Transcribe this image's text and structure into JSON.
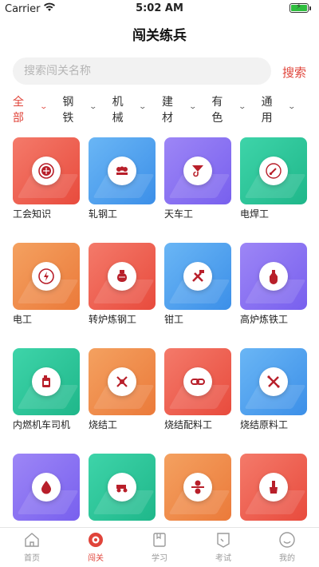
{
  "status": {
    "carrier": "Carrier",
    "time": "5:02 AM",
    "battery_level": 1.0,
    "battery_color": "#2fbf3f"
  },
  "header": {
    "title": "闯关练兵"
  },
  "search": {
    "placeholder": "搜索闯关名称",
    "value": "",
    "button_label": "搜索"
  },
  "filters": [
    {
      "label": "全部",
      "active": true
    },
    {
      "label": "钢铁",
      "active": false
    },
    {
      "label": "机械",
      "active": false
    },
    {
      "label": "建材",
      "active": false
    },
    {
      "label": "有色",
      "active": false
    },
    {
      "label": "通用",
      "active": false
    }
  ],
  "cards": [
    {
      "label": "工会知识",
      "color": "red",
      "icon": "union-badge-icon"
    },
    {
      "label": "轧钢工",
      "color": "blue",
      "icon": "rolling-mill-icon"
    },
    {
      "label": "天车工",
      "color": "purple",
      "icon": "crane-hook-icon"
    },
    {
      "label": "电焊工",
      "color": "green",
      "icon": "welding-icon"
    },
    {
      "label": "电工",
      "color": "orange",
      "icon": "electric-meter-icon"
    },
    {
      "label": "转炉炼钢工",
      "color": "red",
      "icon": "converter-icon"
    },
    {
      "label": "钳工",
      "color": "blue",
      "icon": "tools-icon"
    },
    {
      "label": "高炉炼铁工",
      "color": "purple",
      "icon": "blast-furnace-icon"
    },
    {
      "label": "内燃机车司机",
      "color": "green",
      "icon": "fuel-can-icon"
    },
    {
      "label": "烧结工",
      "color": "orange",
      "icon": "sinter-icon"
    },
    {
      "label": "烧结配料工",
      "color": "red",
      "icon": "chain-link-icon"
    },
    {
      "label": "烧结原料工",
      "color": "blue",
      "icon": "raw-material-icon"
    },
    {
      "label": "",
      "color": "purple",
      "icon": "droplet-icon"
    },
    {
      "label": "",
      "color": "green",
      "icon": "tractor-icon"
    },
    {
      "label": "",
      "color": "orange",
      "icon": "rollers-icon"
    },
    {
      "label": "",
      "color": "red",
      "icon": "brush-icon"
    }
  ],
  "tabbar": [
    {
      "label": "首页",
      "icon": "home-icon",
      "active": false
    },
    {
      "label": "闯关",
      "icon": "challenge-icon",
      "active": true
    },
    {
      "label": "学习",
      "icon": "book-icon",
      "active": false
    },
    {
      "label": "考试",
      "icon": "exam-icon",
      "active": false
    },
    {
      "label": "我的",
      "icon": "profile-icon",
      "active": false
    }
  ],
  "colors": {
    "accent": "#e0443a",
    "icon_fill": "#b81f2a"
  }
}
